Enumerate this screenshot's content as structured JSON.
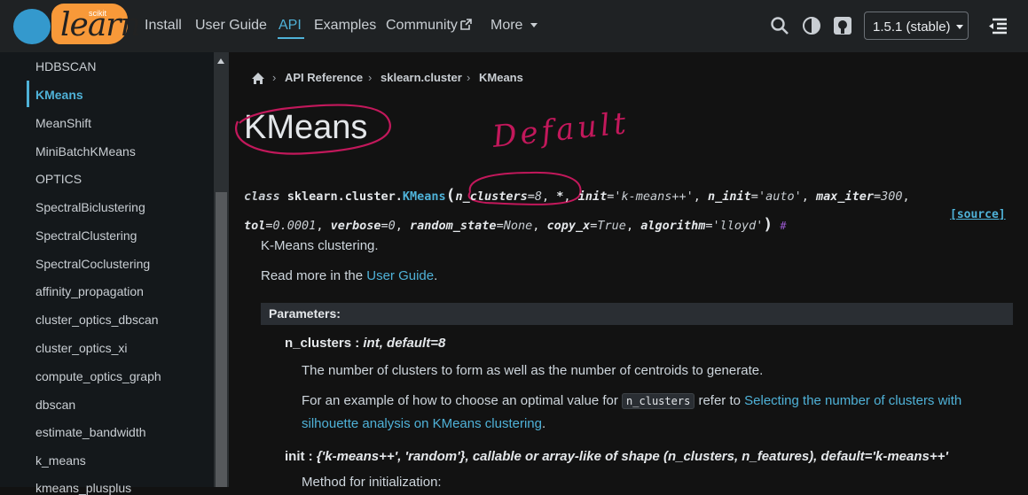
{
  "logo": {
    "top_text": "scikit",
    "main_text": "learn"
  },
  "nav": {
    "links": [
      "Install",
      "User Guide",
      "API",
      "Examples",
      "Community",
      "More"
    ],
    "version": "1.5.1 (stable)",
    "accent_color": "#4fb2d8"
  },
  "sidebar": {
    "items": [
      "HDBSCAN",
      "KMeans",
      "MeanShift",
      "MiniBatchKMeans",
      "OPTICS",
      "SpectralBiclustering",
      "SpectralClustering",
      "SpectralCoclustering",
      "affinity_propagation",
      "cluster_optics_dbscan",
      "cluster_optics_xi",
      "compute_optics_graph",
      "dbscan",
      "estimate_bandwidth",
      "k_means",
      "kmeans_plusplus"
    ],
    "active": "KMeans"
  },
  "breadcrumb": {
    "items": [
      "API Reference",
      "sklearn.cluster",
      "KMeans"
    ]
  },
  "page": {
    "title": "KMeans",
    "annotation": "Default",
    "annotation_color": "#c2185b"
  },
  "signature": {
    "prefix": "class",
    "module": "sklearn.cluster.",
    "name": "KMeans",
    "params": [
      {
        "name": "n_clusters",
        "default": "8"
      },
      {
        "name": "*",
        "default": ""
      },
      {
        "name": "init",
        "default": "'k-means++'"
      },
      {
        "name": "n_init",
        "default": "'auto'"
      },
      {
        "name": "max_iter",
        "default": "300"
      },
      {
        "name": "tol",
        "default": "0.0001"
      },
      {
        "name": "verbose",
        "default": "0"
      },
      {
        "name": "random_state",
        "default": "None"
      },
      {
        "name": "copy_x",
        "default": "True"
      },
      {
        "name": "algorithm",
        "default": "'lloyd'"
      }
    ],
    "source_label": "[source]",
    "permalink": "#"
  },
  "content": {
    "summary": "K-Means clustering.",
    "read_more_prefix": "Read more in the ",
    "read_more_link": "User Guide",
    "read_more_suffix": ".",
    "params_header": "Parameters:",
    "param1": {
      "name": "n_clusters",
      "type": "int, default=8",
      "desc1": "The number of clusters to form as well as the number of centroids to generate.",
      "desc2_prefix": "For an example of how to choose an optimal value for ",
      "desc2_code": "n_clusters",
      "desc2_mid": " refer to ",
      "desc2_link1": "Selecting the number of clusters with",
      "desc2_link2": "silhouette analysis on KMeans clustering",
      "desc2_suffix": "."
    },
    "param2": {
      "name": "init",
      "type": "{'k-means++', 'random'}, callable or array-like of shape (n_clusters, n_features), default='k-means++'",
      "desc1": "Method for initialization:"
    }
  }
}
